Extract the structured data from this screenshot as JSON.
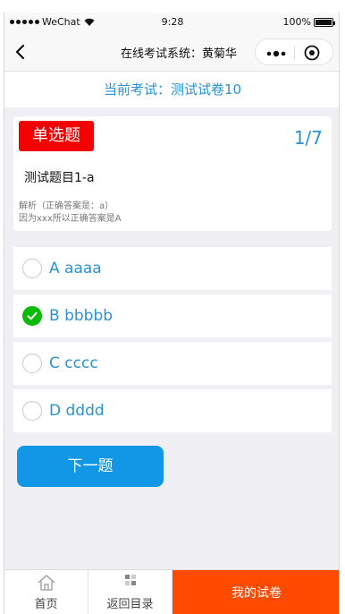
{
  "status_bar": {
    "carrier": "WeChat",
    "time": "9:28",
    "battery": "100%",
    "battery_level": 1.0
  },
  "nav": {
    "title": "在线考试系统：黄菊华",
    "icons": [
      "back-icon",
      "more-icon",
      "close-icon"
    ]
  },
  "exam": {
    "title": "当前考试：测试试卷10"
  },
  "question": {
    "type_label": "单选题",
    "counter": "1/7",
    "title": "测试题目1-a",
    "analysis": "解析（正确答案是：a）",
    "explanation": "因为xxx所以正确答案是A"
  },
  "options": [
    {
      "label": "A aaaa",
      "checked": false
    },
    {
      "label": "B bbbbb",
      "checked": true
    },
    {
      "label": "C cccc",
      "checked": false
    },
    {
      "label": "D dddd",
      "checked": false
    }
  ],
  "next_button": "下一题",
  "tabbar": {
    "home": "首页",
    "catalog": "返回目录",
    "my_papers": "我的试卷"
  },
  "colors": {
    "accent": "#2a92d6",
    "type_badge": "#f40000",
    "check": "#09bb07",
    "next_button": "#1297e6",
    "my_papers_tab": "#ff4a00"
  }
}
